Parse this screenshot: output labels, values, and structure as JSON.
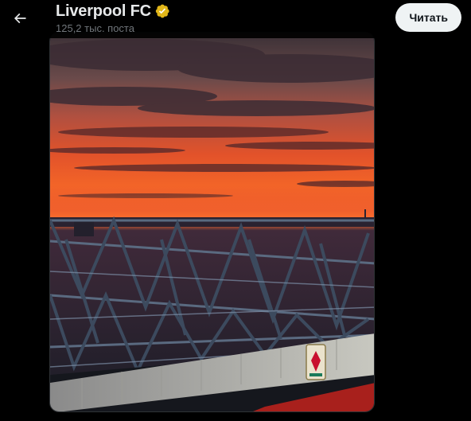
{
  "header": {
    "back_icon": "arrow-left-icon",
    "title": "Liverpool FC",
    "verified_icon": "verified-gold-badge-icon",
    "subtitle": "125,2 тыс. поста",
    "read_button_label": "Читать"
  },
  "media": {
    "description_icon": "photo",
    "accent_colors": {
      "sky_red": "#d9361a",
      "sky_orange": "#f06a2a",
      "verified_gold": "#e2b719"
    }
  }
}
